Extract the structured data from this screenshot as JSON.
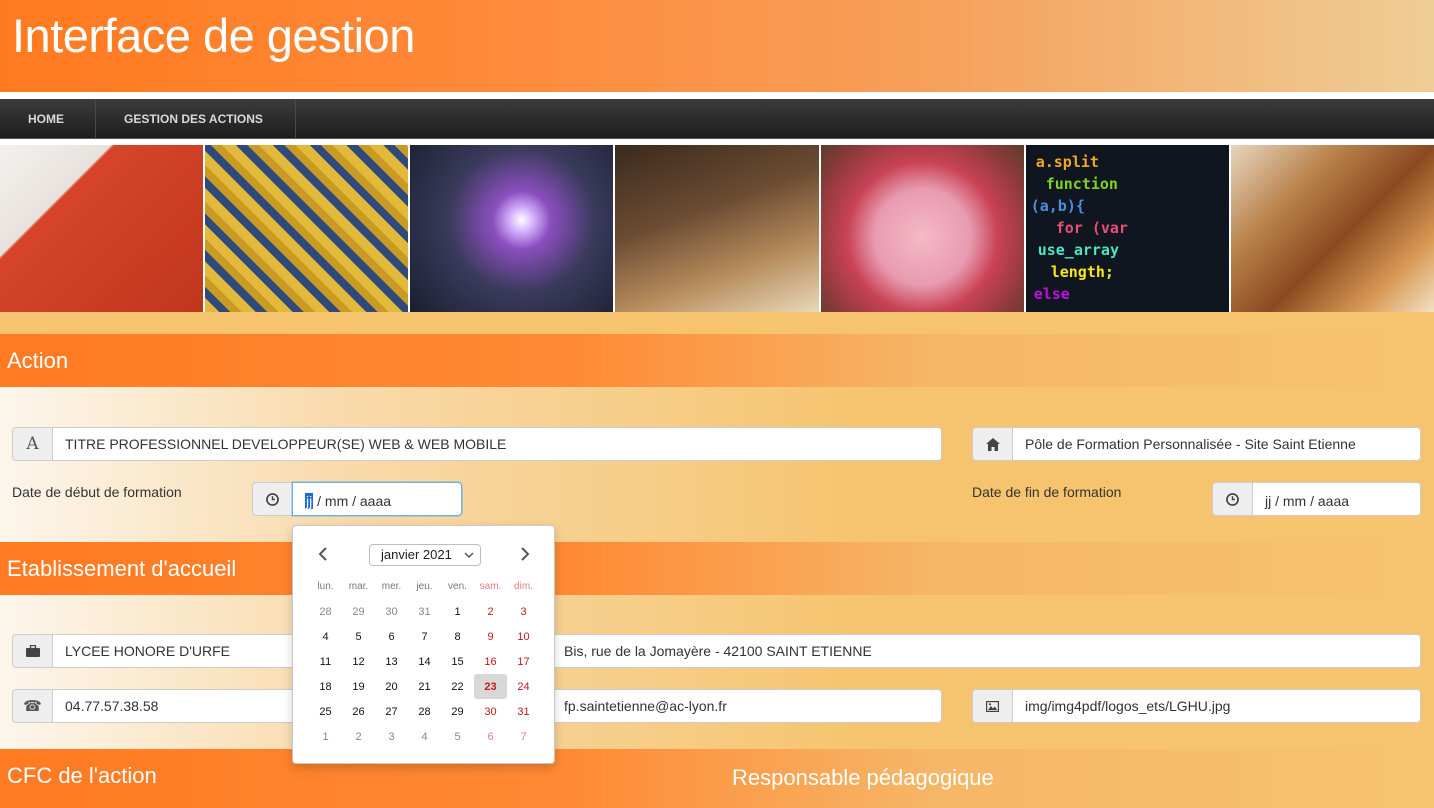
{
  "header": {
    "title": "Interface de gestion"
  },
  "nav": {
    "home": "HOME",
    "actions": "GESTION DES ACTIONS"
  },
  "sections": {
    "action": "Action",
    "etablissement": "Etablissement d'accueil",
    "cfc": "CFC de l'action",
    "responsable": "Responsable pédagogique"
  },
  "action": {
    "titre": "TITRE PROFESSIONNEL DEVELOPPEUR(SE) WEB & WEB MOBILE",
    "pole": "Pôle de Formation Personnalisée - Site Saint Etienne",
    "date_debut_label": "Date de début de formation",
    "date_fin_label": "Date de fin de formation",
    "date_debut_day": "jj",
    "date_debut_rest": "/ mm / aaaa",
    "date_fin_value": "jj / mm / aaaa"
  },
  "etablissement": {
    "nom": "LYCEE HONORE D'URFE",
    "adresse": "Bis, rue de la Jomayère - 42100 SAINT ETIENNE",
    "telephone": "04.77.57.38.58",
    "email": "fp.saintetienne@ac-lyon.fr",
    "logo": "img/img4pdf/logos_ets/LGHU.jpg"
  },
  "calendar": {
    "month_label": "janvier 2021",
    "weekdays": [
      "lun.",
      "mar.",
      "mer.",
      "jeu.",
      "ven.",
      "sam.",
      "dim."
    ],
    "weeks": [
      [
        "28",
        "29",
        "30",
        "31",
        "1",
        "2",
        "3"
      ],
      [
        "4",
        "5",
        "6",
        "7",
        "8",
        "9",
        "10"
      ],
      [
        "11",
        "12",
        "13",
        "14",
        "15",
        "16",
        "17"
      ],
      [
        "18",
        "19",
        "20",
        "21",
        "22",
        "23",
        "24"
      ],
      [
        "25",
        "26",
        "27",
        "28",
        "29",
        "30",
        "31"
      ],
      [
        "1",
        "2",
        "3",
        "4",
        "5",
        "6",
        "7"
      ]
    ],
    "today": "23",
    "colors": {
      "weekend": "#c41818",
      "today_bg": "#d8d8d8"
    }
  },
  "icons": {
    "titre": "font-letter-icon",
    "pole": "home-icon",
    "date": "clock-icon",
    "etab": "briefcase-icon",
    "tel": "phone-icon",
    "logo": "picture-icon"
  },
  "colors": {
    "accent_orange": "#ff7a22",
    "background": "#f6c46f",
    "navbar": "#1d1d1d"
  }
}
